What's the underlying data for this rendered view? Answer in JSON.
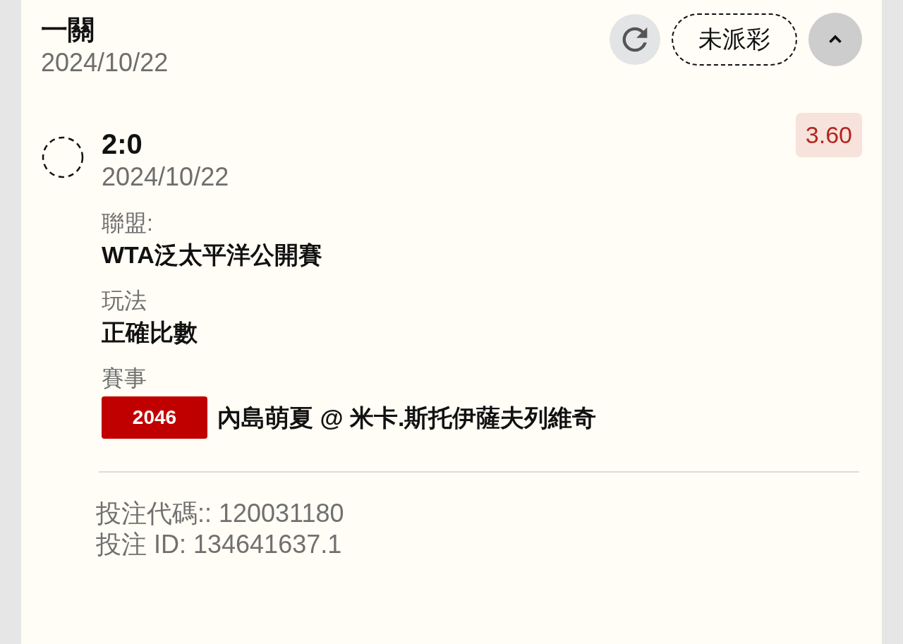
{
  "bet": {
    "title": "一關",
    "date": "2024/10/22",
    "status": {
      "label": "未派彩",
      "kind": "pending"
    },
    "expanded": true
  },
  "leg": {
    "settled": false,
    "selection": "2:0",
    "date": "2024/10/22",
    "odds": "3.60",
    "fields": [
      {
        "label": "聯盟:",
        "kind": "text",
        "value": "WTA泛太平洋公開賽"
      },
      {
        "label": "玩法",
        "kind": "text",
        "value": "正確比數"
      },
      {
        "label": "賽事",
        "kind": "event",
        "number": "2046",
        "value": "內島萌夏 @ 米卡.斯托伊薩夫列維奇"
      }
    ]
  },
  "footer": [
    "投注代碼:: 120031180",
    "投注 ID: 134641637.1"
  ]
}
